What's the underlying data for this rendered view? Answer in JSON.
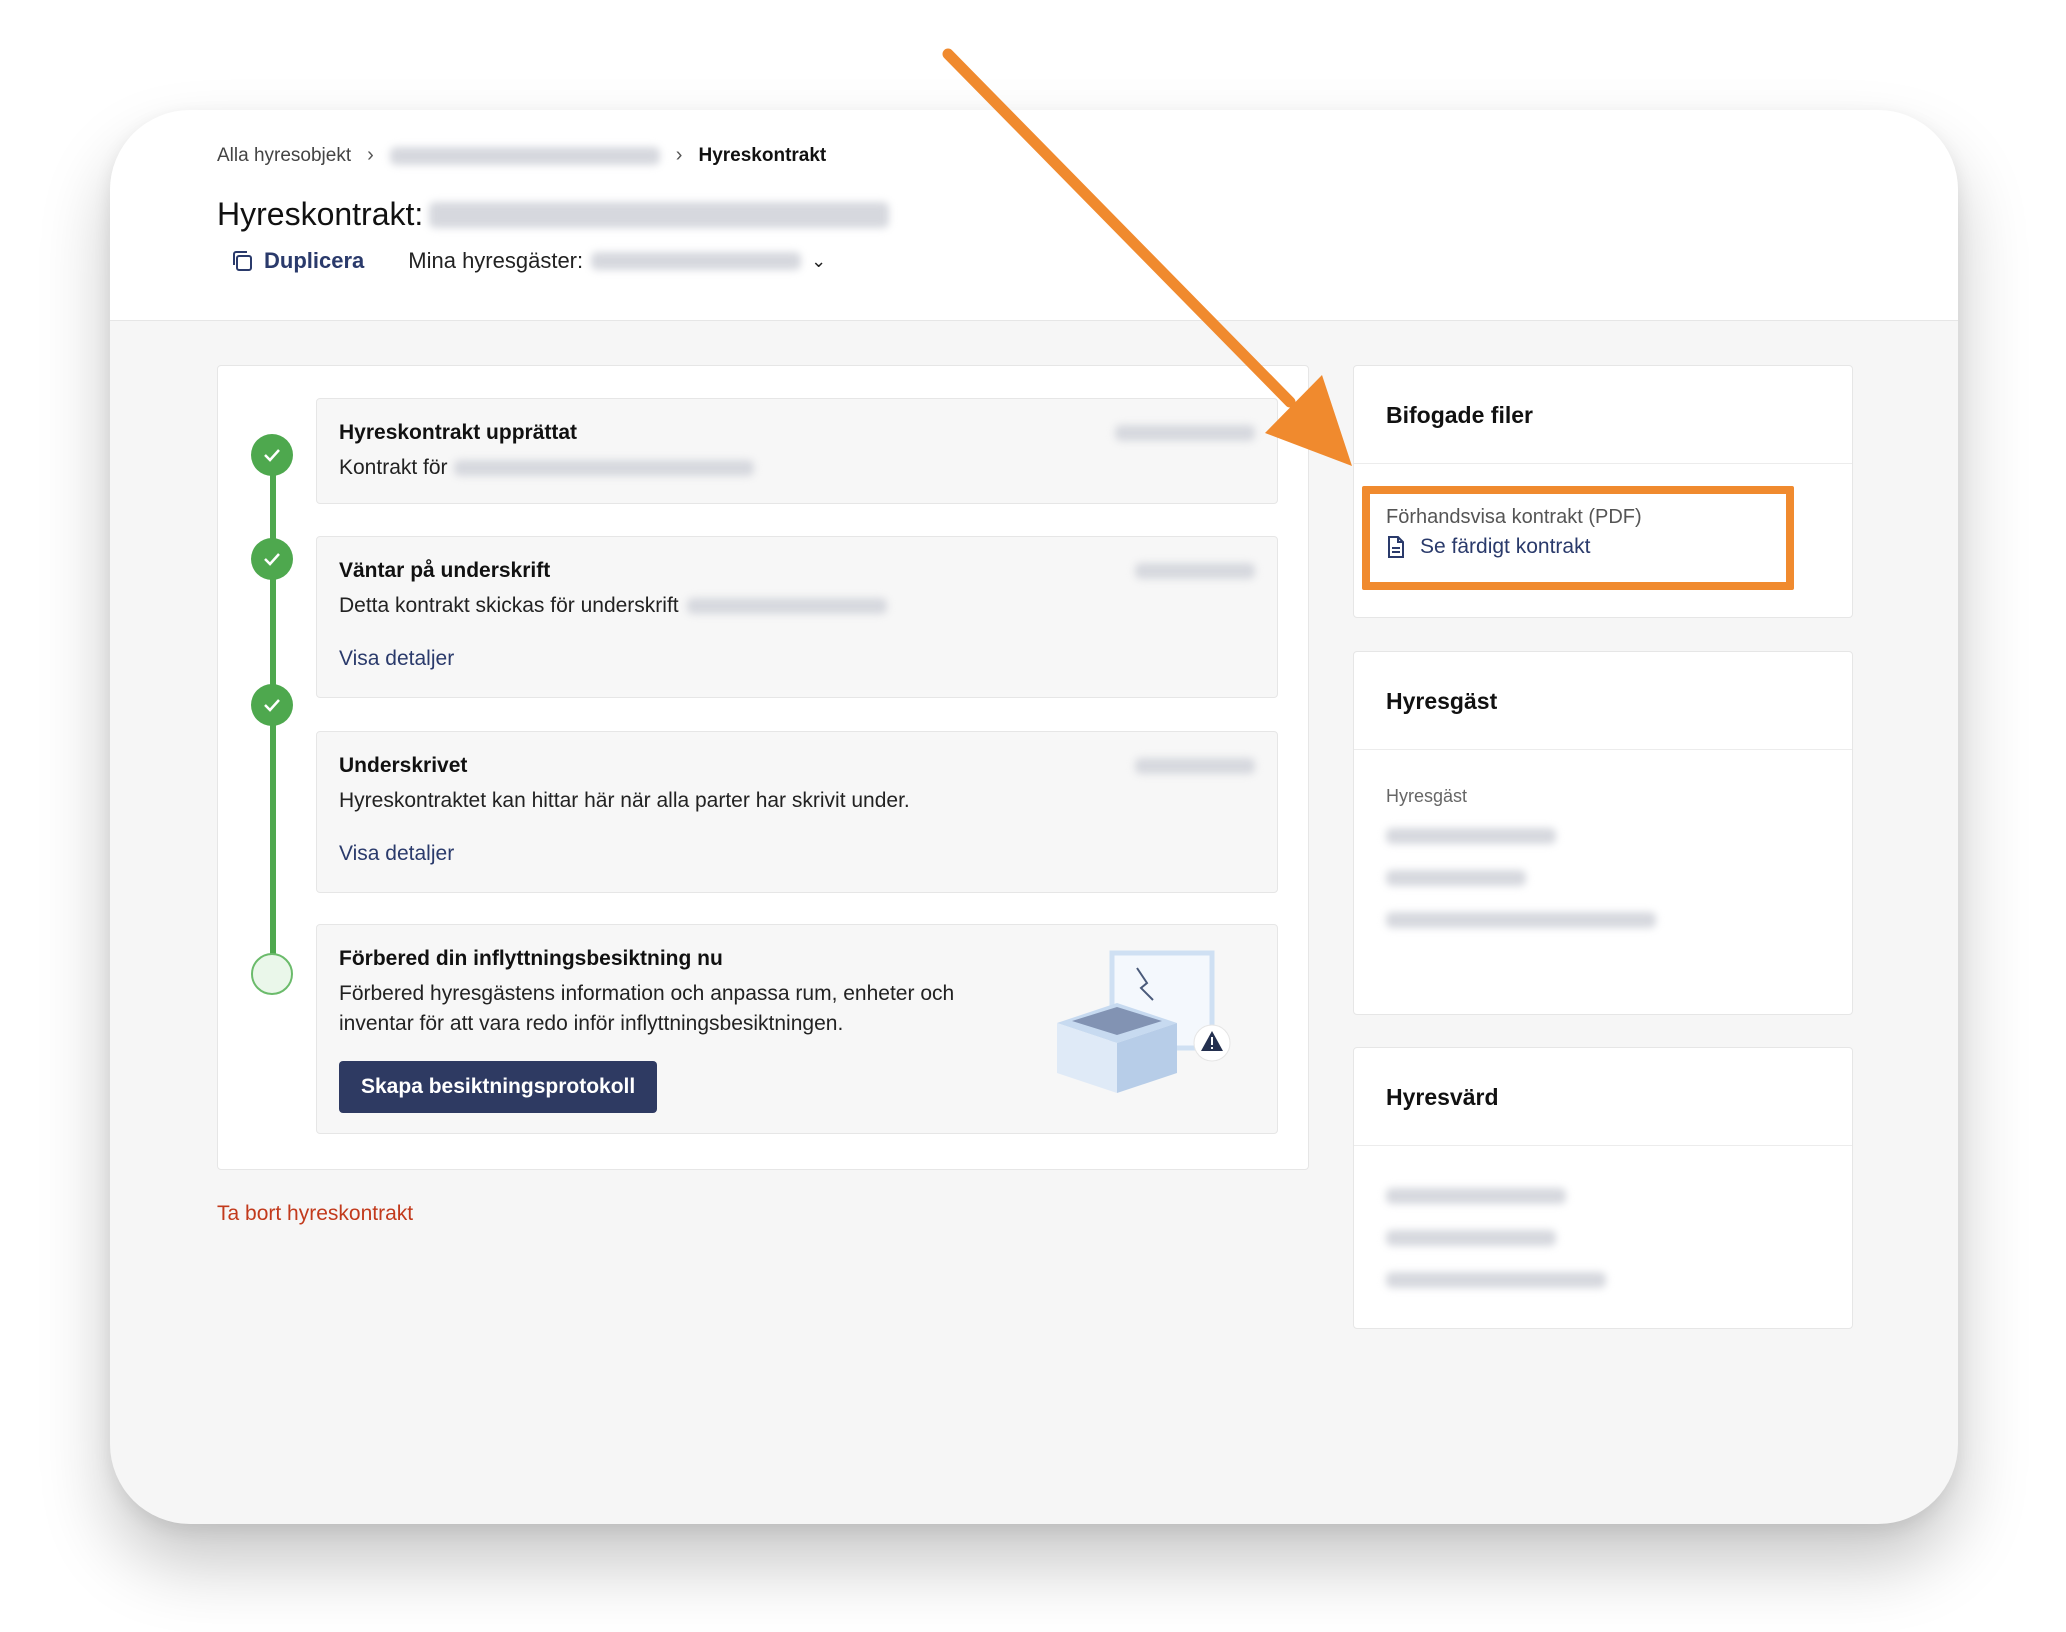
{
  "breadcrumb": {
    "root": "Alla hyresobjekt",
    "current": "Hyreskontrakt"
  },
  "page": {
    "title_prefix": "Hyreskontrakt:",
    "duplicate_label": "Duplicera",
    "tenants_label": "Mina hyresgäster:"
  },
  "timeline": {
    "steps": [
      {
        "title": "Hyreskontrakt upprättat",
        "text": "Kontrakt för"
      },
      {
        "title": "Väntar på underskrift",
        "text": "Detta kontrakt skickas för underskrift",
        "link": "Visa detaljer"
      },
      {
        "title": "Underskrivet",
        "text": "Hyreskontraktet kan hittar här när alla parter har skrivit under.",
        "link": "Visa detaljer"
      },
      {
        "title": "Förbered din inflyttningsbesiktning nu",
        "text": "Förbered hyresgästens information och anpassa rum, enheter och inventar för att vara redo inför inflyttningsbesiktningen.",
        "button": "Skapa besiktningsprotokoll"
      }
    ]
  },
  "delete_label": "Ta bort hyreskontrakt",
  "files": {
    "title": "Bifogade filer",
    "preview_label": "Förhandsvisa kontrakt (PDF)",
    "link": "Se färdigt kontrakt"
  },
  "tenant": {
    "title": "Hyresgäst",
    "label": "Hyresgäst"
  },
  "landlord": {
    "title": "Hyresvärd"
  },
  "colors": {
    "accent": "#2e3a62",
    "success": "#4ea84e",
    "danger": "#c23a1c",
    "highlight": "#f08a2e"
  }
}
